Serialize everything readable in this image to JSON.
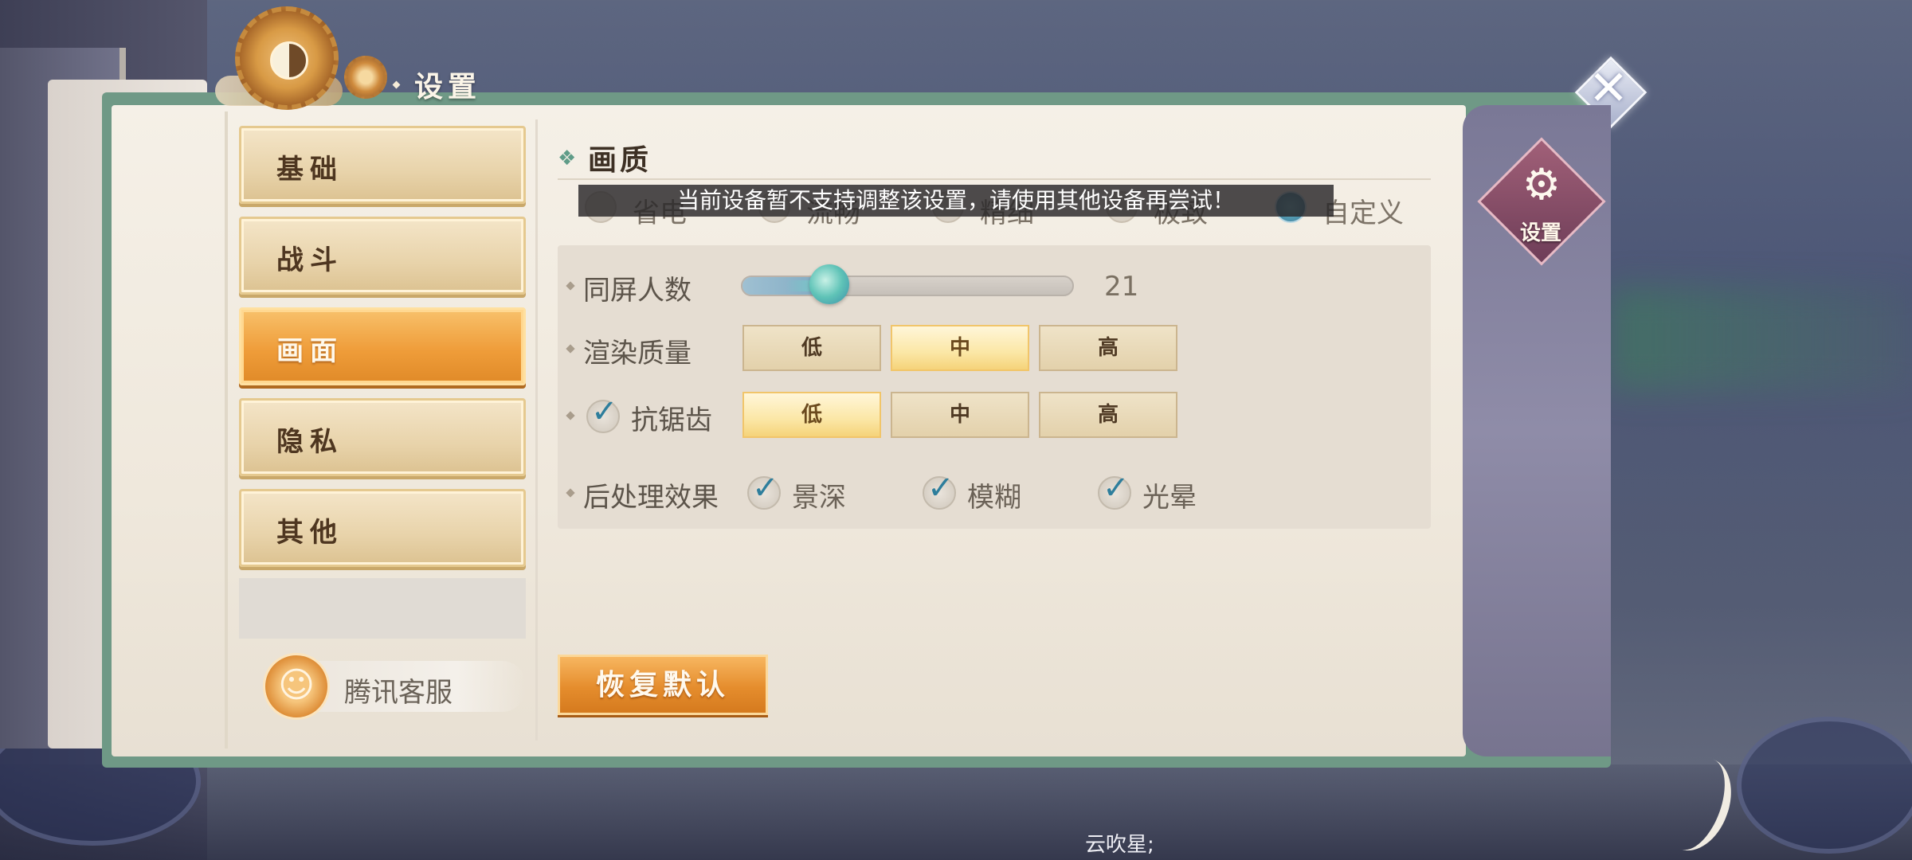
{
  "header": {
    "title": "设置",
    "close_icon": "close-x-icon"
  },
  "sidebar": {
    "tabs": [
      {
        "label": "基础",
        "active": false
      },
      {
        "label": "战斗",
        "active": false
      },
      {
        "label": "画面",
        "active": true
      },
      {
        "label": "隐私",
        "active": false
      },
      {
        "label": "其他",
        "active": false
      }
    ],
    "service_label": "腾讯客服"
  },
  "right_panel": {
    "settings_label": "设置"
  },
  "content": {
    "section_title": "画质",
    "quality_presets": [
      {
        "label": "省电",
        "checked": false
      },
      {
        "label": "流畅",
        "checked": false
      },
      {
        "label": "精细",
        "checked": false
      },
      {
        "label": "极致",
        "checked": false
      },
      {
        "label": "自定义",
        "checked": true
      }
    ],
    "toast": "当前设备暂不支持调整该设置，请使用其他设备再尝试！",
    "player_count": {
      "label": "同屏人数",
      "value": "21",
      "fill_fraction": 0.3
    },
    "render_quality": {
      "label": "渲染质量",
      "options": [
        "低",
        "中",
        "高"
      ],
      "selected": "中"
    },
    "anti_aliasing": {
      "label": "抗锯齿",
      "enabled": true,
      "options": [
        "低",
        "中",
        "高"
      ],
      "selected": "低"
    },
    "post_processing": {
      "label": "后处理效果",
      "items": [
        {
          "label": "景深",
          "checked": true
        },
        {
          "label": "模糊",
          "checked": true
        },
        {
          "label": "光晕",
          "checked": true
        }
      ]
    },
    "reset_label": "恢复默认"
  },
  "chat": {
    "text": "云吹星;"
  }
}
